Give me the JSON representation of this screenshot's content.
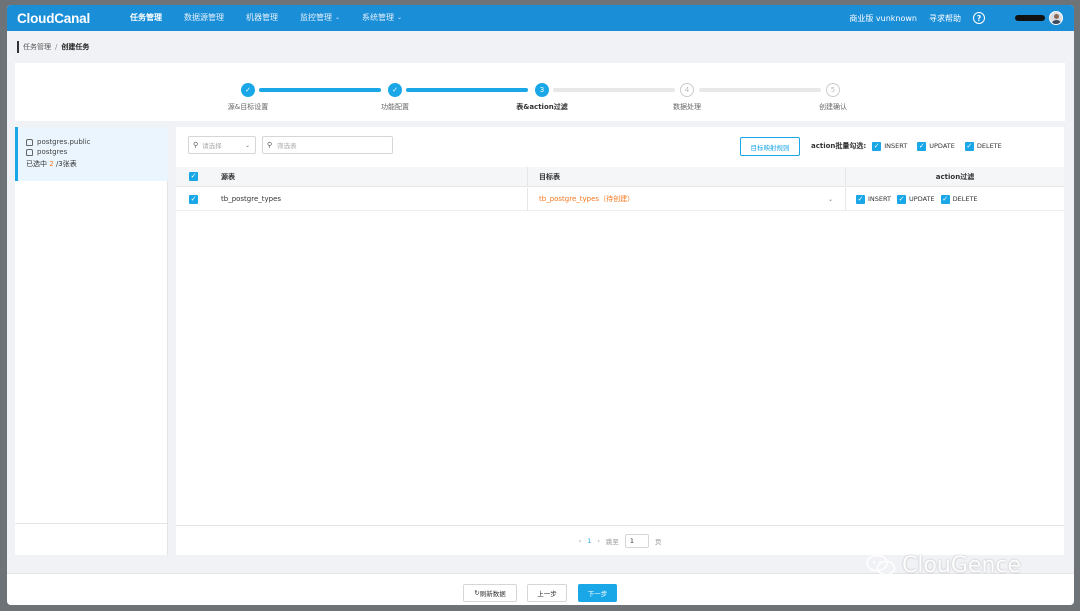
{
  "header": {
    "logo": "CloudCanal",
    "nav": [
      {
        "label": "任务管理",
        "active": true,
        "dropdown": false
      },
      {
        "label": "数据源管理",
        "active": false,
        "dropdown": false
      },
      {
        "label": "机器管理",
        "active": false,
        "dropdown": false
      },
      {
        "label": "监控管理",
        "active": false,
        "dropdown": true
      },
      {
        "label": "系统管理",
        "active": false,
        "dropdown": true
      }
    ],
    "edition": "商业版 vunknown",
    "help_link": "寻求帮助",
    "help_icon": "?"
  },
  "breadcrumb": {
    "parent": "任务管理",
    "separator": "/",
    "current": "创建任务"
  },
  "steps": [
    {
      "label": "源&目标设置",
      "status": "done",
      "marker": "✓"
    },
    {
      "label": "功能配置",
      "status": "done",
      "marker": "✓"
    },
    {
      "label": "表&action过滤",
      "status": "current",
      "marker": "3"
    },
    {
      "label": "数据处理",
      "status": "todo",
      "marker": "4"
    },
    {
      "label": "创建确认",
      "status": "todo",
      "marker": "5"
    }
  ],
  "left_panel": {
    "schema": "postgres.public",
    "database": "postgres",
    "selected_prefix": "已选中",
    "selected_count": "2",
    "selected_suffix": "/3张表"
  },
  "filters": {
    "db_select_placeholder": "请选择",
    "table_search_placeholder": "筛选表",
    "mapping_button": "目标映射规则",
    "batch_label": "action批量勾选:",
    "batch_actions": [
      "INSERT",
      "UPDATE",
      "DELETE"
    ]
  },
  "table": {
    "headers": {
      "source": "源表",
      "target": "目标表",
      "action": "action过滤"
    },
    "rows": [
      {
        "source": "tb_postgre_types",
        "target": "tb_postgre_types（待创建）",
        "actions": [
          "INSERT",
          "UPDATE",
          "DELETE"
        ]
      }
    ]
  },
  "pagination": {
    "current_page": "1",
    "jump_label": "跳至",
    "jump_value": "1",
    "page_suffix": "页"
  },
  "footer": {
    "refresh": "刷新数据",
    "prev": "上一步",
    "next": "下一步"
  },
  "watermark": "ClouGence",
  "colors": {
    "brand": "#1b8ed8",
    "accent": "#1aa7e8",
    "warning": "#f5781f"
  }
}
